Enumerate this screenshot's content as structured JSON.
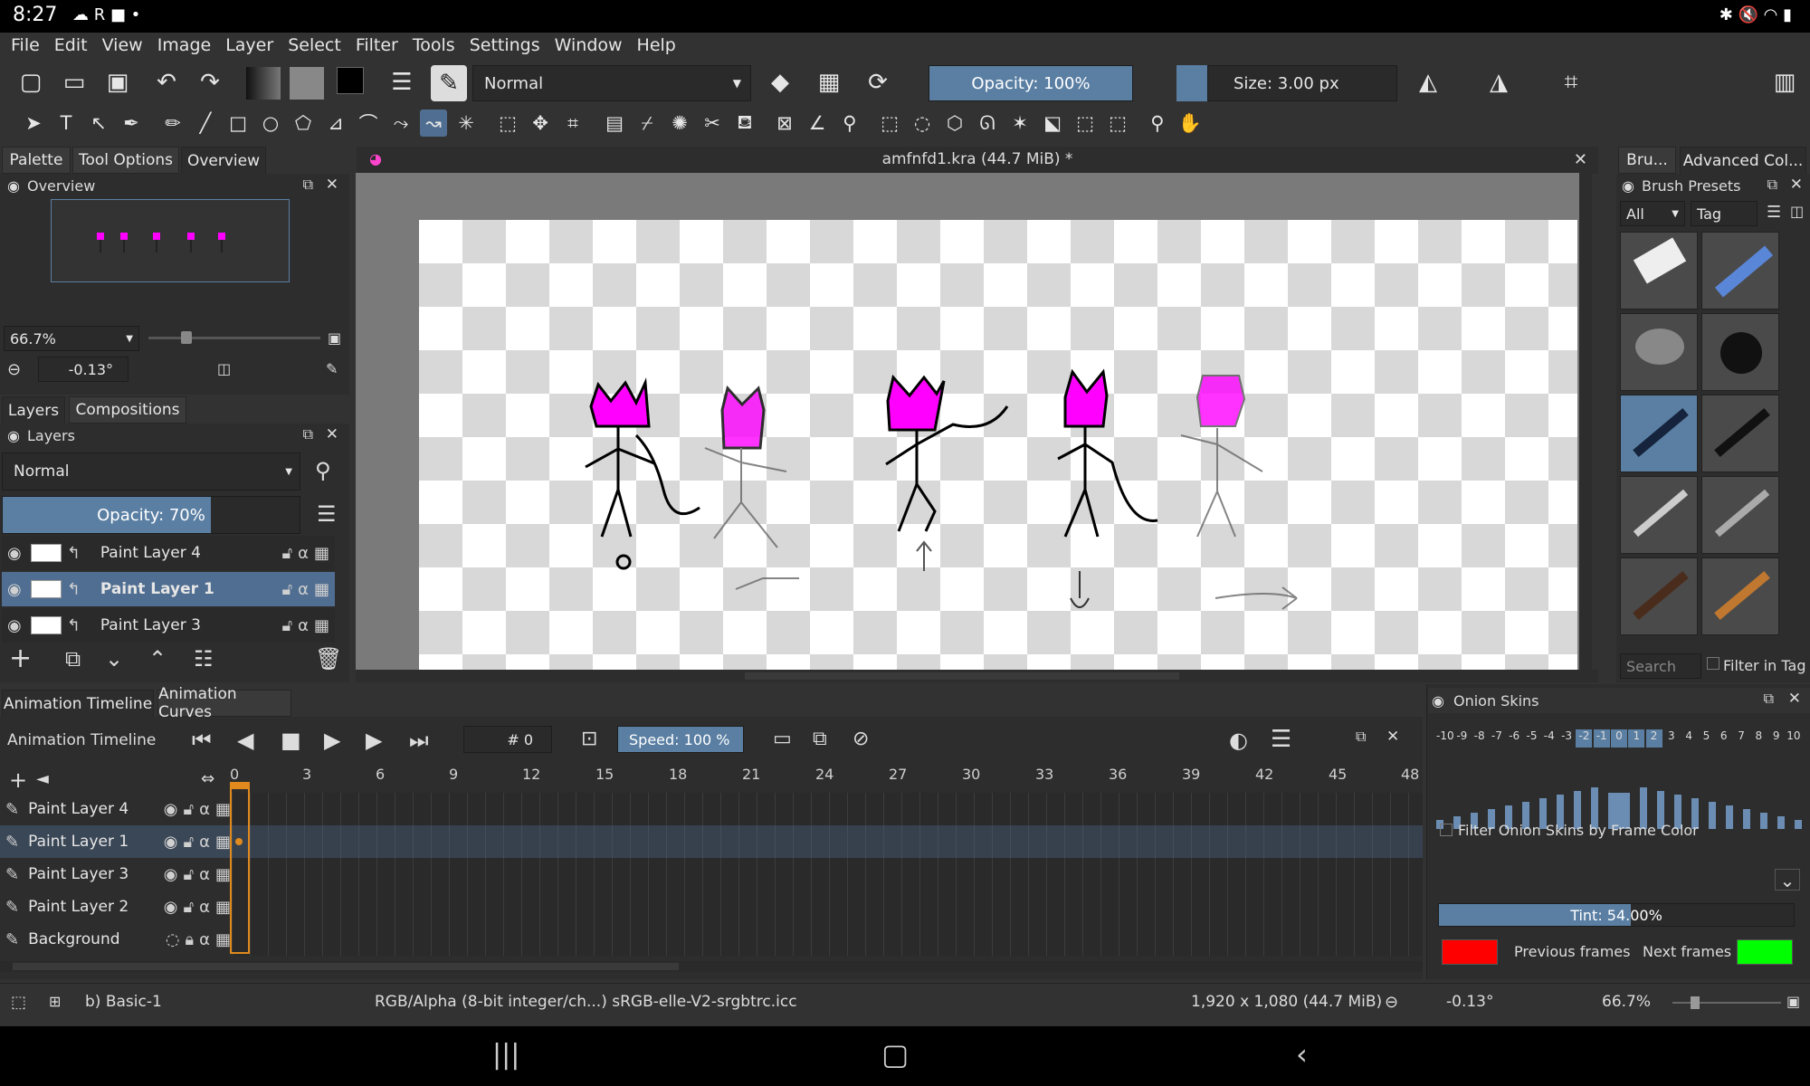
{
  "status_bar": {
    "time": "8:27",
    "left_icons": "☁ R ■ •",
    "right_icons": "✱ 🔇 ◠ ▮"
  },
  "menu": [
    "File",
    "Edit",
    "View",
    "Image",
    "Layer",
    "Select",
    "Filter",
    "Tools",
    "Settings",
    "Window",
    "Help"
  ],
  "toolbar": {
    "blend_mode": "Normal",
    "opacity": "Opacity: 100%",
    "opacity_fraction": 1.0,
    "size": "Size: 3.00 px"
  },
  "left_tabs": [
    "Palette",
    "Tool Options",
    "Overview"
  ],
  "overview": {
    "title": "Overview",
    "zoom": "66.7%",
    "rotation": "-0.13°"
  },
  "layers_tabs": [
    "Layers",
    "Compositions"
  ],
  "layers": {
    "title": "Layers",
    "blend": "Normal",
    "opacity": "Opacity:  70%",
    "opacity_fraction": 0.7,
    "items": [
      {
        "name": "Paint Layer 4",
        "selected": false
      },
      {
        "name": "Paint Layer 1",
        "selected": true
      },
      {
        "name": "Paint Layer 3",
        "selected": false
      }
    ]
  },
  "document": {
    "title": "amfnfd1.kra (44.7 MiB)  *"
  },
  "right_tabs": [
    "Bru...",
    "Advanced Col..."
  ],
  "brush_presets": {
    "title": "Brush Presets",
    "filter": "All",
    "tag": "Tag",
    "search": "Search",
    "filter_in_tag": "Filter in Tag"
  },
  "timeline": {
    "tabs": [
      "Animation Timeline",
      "Animation Curves"
    ],
    "title": "Animation Timeline",
    "frame": "# 0",
    "speed": "Speed: 100 %",
    "ruler": [
      "0",
      "3",
      "6",
      "9",
      "12",
      "15",
      "18",
      "21",
      "24",
      "27",
      "30",
      "33",
      "36",
      "39",
      "42",
      "45",
      "48"
    ],
    "layers": [
      "Paint Layer 4",
      "Paint Layer 1",
      "Paint Layer 3",
      "Paint Layer 2",
      "Background"
    ]
  },
  "onion": {
    "title": "Onion Skins",
    "scale": [
      "-10",
      "-9",
      "-8",
      "-7",
      "-6",
      "-5",
      "-4",
      "-3",
      "-2",
      "-1",
      "0",
      "1",
      "2",
      "3",
      "4",
      "5",
      "6",
      "7",
      "8",
      "9",
      "10"
    ],
    "filter": "Filter Onion Skins by Frame Color",
    "tint": "Tint: 54.00%",
    "tint_fraction": 0.54,
    "previous": "Previous frames",
    "next": "Next frames",
    "prev_color": "#ff0000",
    "next_color": "#00ff00"
  },
  "statusline": {
    "brush": "b) Basic-1",
    "color": "RGB/Alpha (8-bit integer/ch...)  sRGB-elle-V2-srgbtrc.icc",
    "dims": "1,920 x 1,080 (44.7 MiB)",
    "rotation": "-0.13°",
    "zoom": "66.7%"
  },
  "colors": {
    "accent": "#5a7fa3",
    "character": "#ff00ff"
  }
}
